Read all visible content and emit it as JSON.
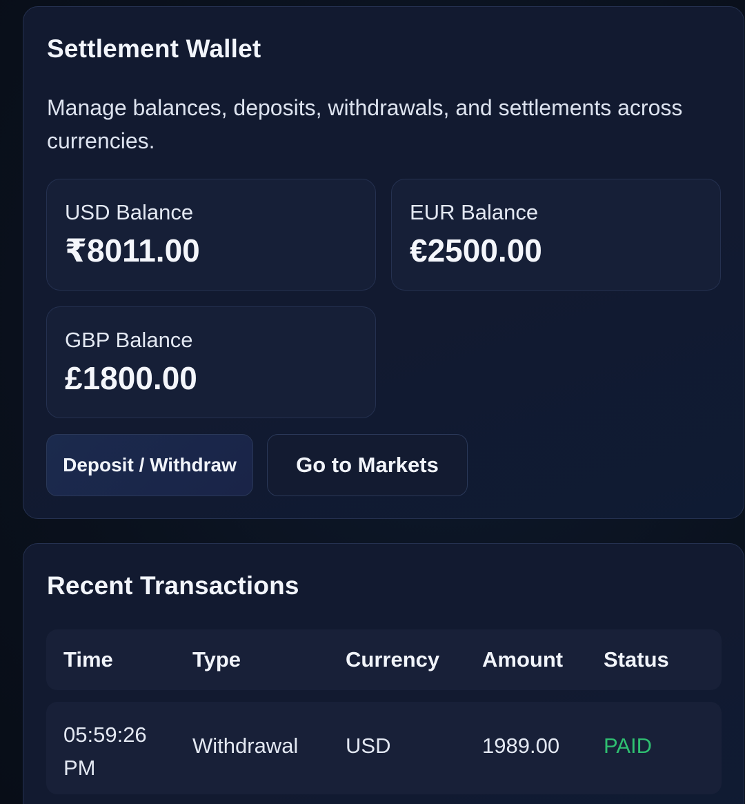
{
  "wallet": {
    "title": "Settlement Wallet",
    "description": "Manage balances, deposits, withdrawals, and settlements across currencies.",
    "balances": [
      {
        "label": "USD Balance",
        "amount": "₹8011.00"
      },
      {
        "label": "EUR Balance",
        "amount": "€2500.00"
      },
      {
        "label": "GBP Balance",
        "amount": "£1800.00"
      }
    ],
    "buttons": {
      "deposit_withdraw": "Deposit / Withdraw",
      "go_to_markets": "Go to Markets"
    }
  },
  "transactions": {
    "title": "Recent Transactions",
    "columns": [
      "Time",
      "Type",
      "Currency",
      "Amount",
      "Status"
    ],
    "rows": [
      {
        "time": "05:59:26 PM",
        "type": "Withdrawal",
        "currency": "USD",
        "amount": "1989.00",
        "status": "PAID"
      }
    ]
  },
  "colors": {
    "status_paid": "#2fbf71",
    "background": "#0b1220",
    "card": "#121a30"
  }
}
